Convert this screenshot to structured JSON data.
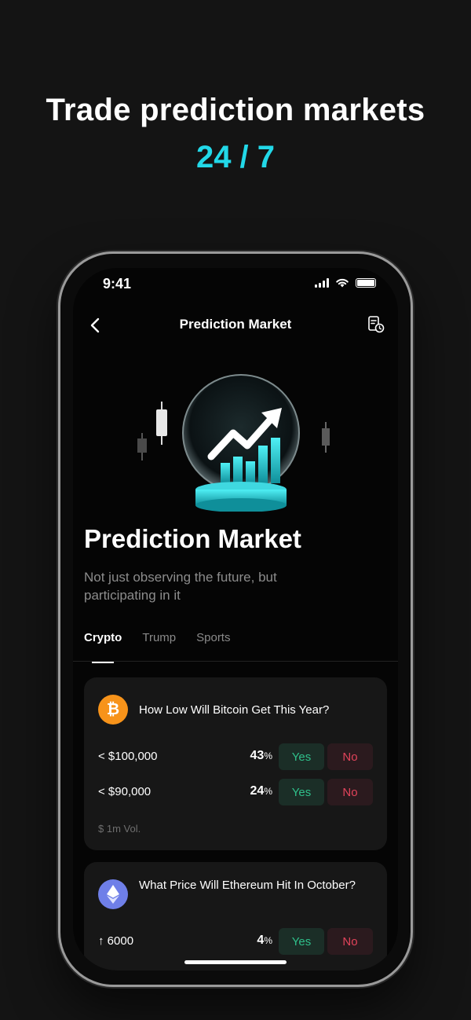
{
  "promo": {
    "headline": "Trade prediction markets",
    "subheadline": "24 / 7"
  },
  "status_bar": {
    "time": "9:41"
  },
  "nav": {
    "title": "Prediction Market"
  },
  "hero": {
    "title": "Prediction Market",
    "subtitle": "Not just observing the future, but participating in it"
  },
  "tabs": [
    {
      "label": "Crypto",
      "active": true
    },
    {
      "label": "Trump",
      "active": false
    },
    {
      "label": "Sports",
      "active": false
    }
  ],
  "markets": [
    {
      "icon": "bitcoin-icon",
      "icon_glyph": "₿",
      "icon_color": "#f7931a",
      "title": "How Low Will Bitcoin Get This Year?",
      "outcomes": [
        {
          "label": "< $100,000",
          "pct": "43",
          "yes": "Yes",
          "no": "No"
        },
        {
          "label": "< $90,000",
          "pct": "24",
          "yes": "Yes",
          "no": "No"
        }
      ],
      "volume": "$ 1m Vol."
    },
    {
      "icon": "ethereum-icon",
      "icon_glyph": "◆",
      "icon_color": "#6f7fe8",
      "title": "What Price Will Ethereum Hit In October?",
      "outcomes": [
        {
          "label": "↑ 6000",
          "pct": "4",
          "yes": "Yes",
          "no": "No"
        }
      ]
    }
  ],
  "units": {
    "percent": "%"
  },
  "colors": {
    "accent": "#22d8e8",
    "yes": "#2fbf8a",
    "no": "#e0435a"
  }
}
